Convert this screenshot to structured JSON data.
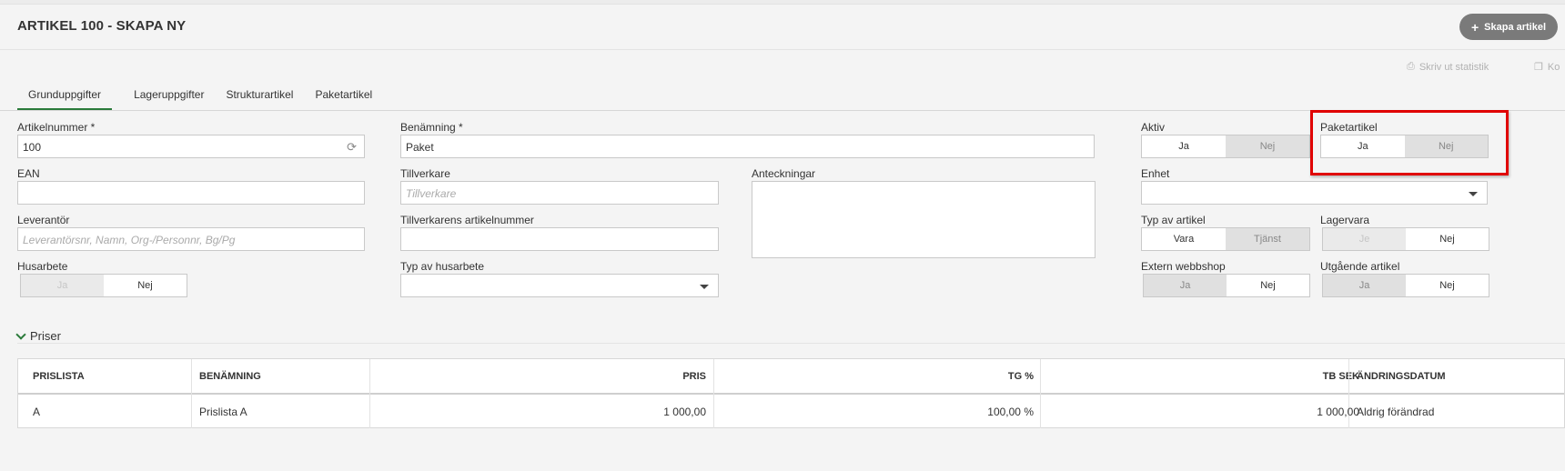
{
  "header": {
    "title": "ARTIKEL 100 - SKAPA NY",
    "create_button": "Skapa artikel",
    "print_link": "Skriv ut statistik",
    "copy_link": "Ko"
  },
  "tabs": [
    "Grunduppgifter",
    "Lageruppgifter",
    "Strukturartikel",
    "Paketartikel"
  ],
  "form": {
    "artikelnummer": {
      "label": "Artikelnummer *",
      "value": "100"
    },
    "benamning": {
      "label": "Benämning *",
      "value": "Paket"
    },
    "ean": {
      "label": "EAN",
      "value": ""
    },
    "tillverkare": {
      "label": "Tillverkare",
      "placeholder": "Tillverkare"
    },
    "anteckningar": {
      "label": "Anteckningar"
    },
    "leverantor": {
      "label": "Leverantör",
      "placeholder": "Leverantörsnr, Namn, Org-/Personnr, Bg/Pg"
    },
    "tillverkarens_artikelnummer": {
      "label": "Tillverkarens artikelnummer",
      "value": ""
    },
    "husarbete": {
      "label": "Husarbete",
      "yes": "Ja",
      "no": "Nej"
    },
    "typ_av_husarbete": {
      "label": "Typ av husarbete",
      "value": ""
    },
    "aktiv": {
      "label": "Aktiv",
      "yes": "Ja",
      "no": "Nej"
    },
    "paketartikel": {
      "label": "Paketartikel",
      "yes": "Ja",
      "no": "Nej"
    },
    "enhet": {
      "label": "Enhet",
      "value": ""
    },
    "typ_av_artikel": {
      "label": "Typ av artikel",
      "yes": "Vara",
      "no": "Tjänst"
    },
    "lagervara": {
      "label": "Lagervara",
      "yes": "Je",
      "no": "Nej"
    },
    "extern_webbshop": {
      "label": "Extern webbshop",
      "yes": "Ja",
      "no": "Nej"
    },
    "utgaende_artikel": {
      "label": "Utgående artikel",
      "yes": "Ja",
      "no": "Nej"
    }
  },
  "prices": {
    "section_title": "Priser",
    "columns": [
      "PRISLISTA",
      "BENÄMNING",
      "PRIS",
      "TG %",
      "TB SEK",
      "ÄNDRINGSDATUM"
    ],
    "rows": [
      {
        "prislista": "A",
        "benamning": "Prislista A",
        "pris": "1 000,00",
        "tg": "100,00 %",
        "tb": "1 000,00",
        "andringsdatum": "Aldrig förändrad"
      }
    ]
  },
  "colors": {
    "accent": "#2a7a3a",
    "highlight": "#e00000",
    "button": "#7a7a7a"
  },
  "icons": [
    "plus-icon",
    "printer-icon",
    "copy-icon",
    "refresh-icon",
    "chevron-down-icon",
    "dropdown-arrow-icon"
  ]
}
